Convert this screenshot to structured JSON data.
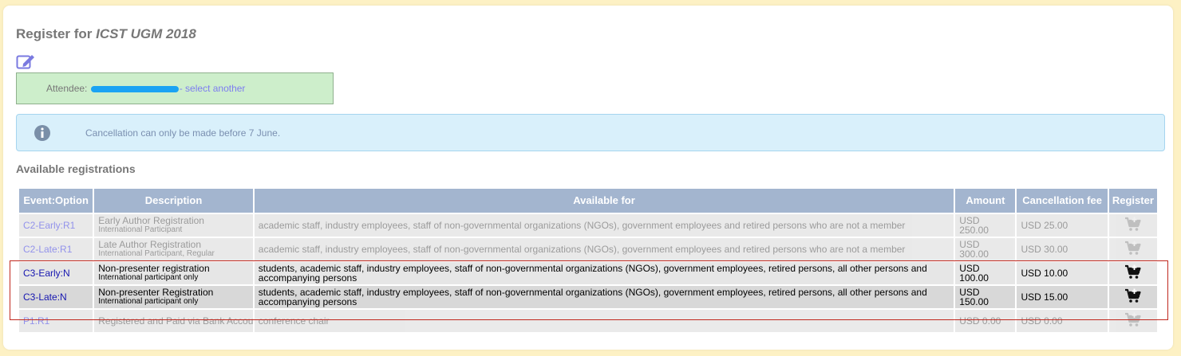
{
  "page": {
    "title_prefix": "Register for ",
    "conference": "ICST UGM 2018"
  },
  "attendee": {
    "label": "Attendee: ",
    "select_link": "- select another"
  },
  "notice": {
    "text": "Cancellation can only be made before 7 June."
  },
  "section": {
    "title": "Available registrations"
  },
  "table": {
    "headers": [
      "Event:Option",
      "Description",
      "Available for",
      "Amount",
      "Cancellation fee",
      "Register"
    ],
    "rows": [
      {
        "code": "C2-Early:R1",
        "desc": "Early Author Registration",
        "sub": "International Participant",
        "available": "academic staff, industry employees, staff of non-governmental organizations (NGOs), government employees and retired persons who are not a member",
        "amount": "USD 250.00",
        "fee": "USD 25.00",
        "enabled": false
      },
      {
        "code": "C2-Late:R1",
        "desc": "Late Author Registration",
        "sub": "International Participant, Regular",
        "available": "academic staff, industry employees, staff of non-governmental organizations (NGOs), government employees and retired persons who are not a member",
        "amount": "USD 300.00",
        "fee": "USD 30.00",
        "enabled": false
      },
      {
        "code": "C3-Early:N",
        "desc": "Non-presenter registration",
        "sub": "International participant only",
        "available": "students, academic staff, industry employees, staff of non-governmental organizations (NGOs), government employees, retired persons, all other persons and accompanying persons",
        "amount": "USD 100.00",
        "fee": "USD 10.00",
        "enabled": true
      },
      {
        "code": "C3-Late:N",
        "desc": "Non-presenter Registration",
        "sub": "International participant only",
        "available": "students, academic staff, industry employees, staff of non-governmental organizations (NGOs), government employees, retired persons, all other persons and accompanying persons",
        "amount": "USD 150.00",
        "fee": "USD 15.00",
        "enabled": true
      },
      {
        "code": "P1:R1",
        "desc": "Registered and Paid via Bank Account",
        "sub": "",
        "available": "conference chair",
        "amount": "USD 0.00",
        "fee": "USD 0.00",
        "enabled": false
      }
    ]
  },
  "icons": {
    "edit": "edit-pencil-icon",
    "info": "info-icon",
    "cart": "add-to-cart-icon"
  },
  "colors": {
    "background": "#fdf1c4",
    "header": "#a3b5cf",
    "attendee_bg": "#cdeecb",
    "info_bg": "#d9f0fb",
    "link": "#7d7df0",
    "highlight_border": "#c0281e"
  }
}
